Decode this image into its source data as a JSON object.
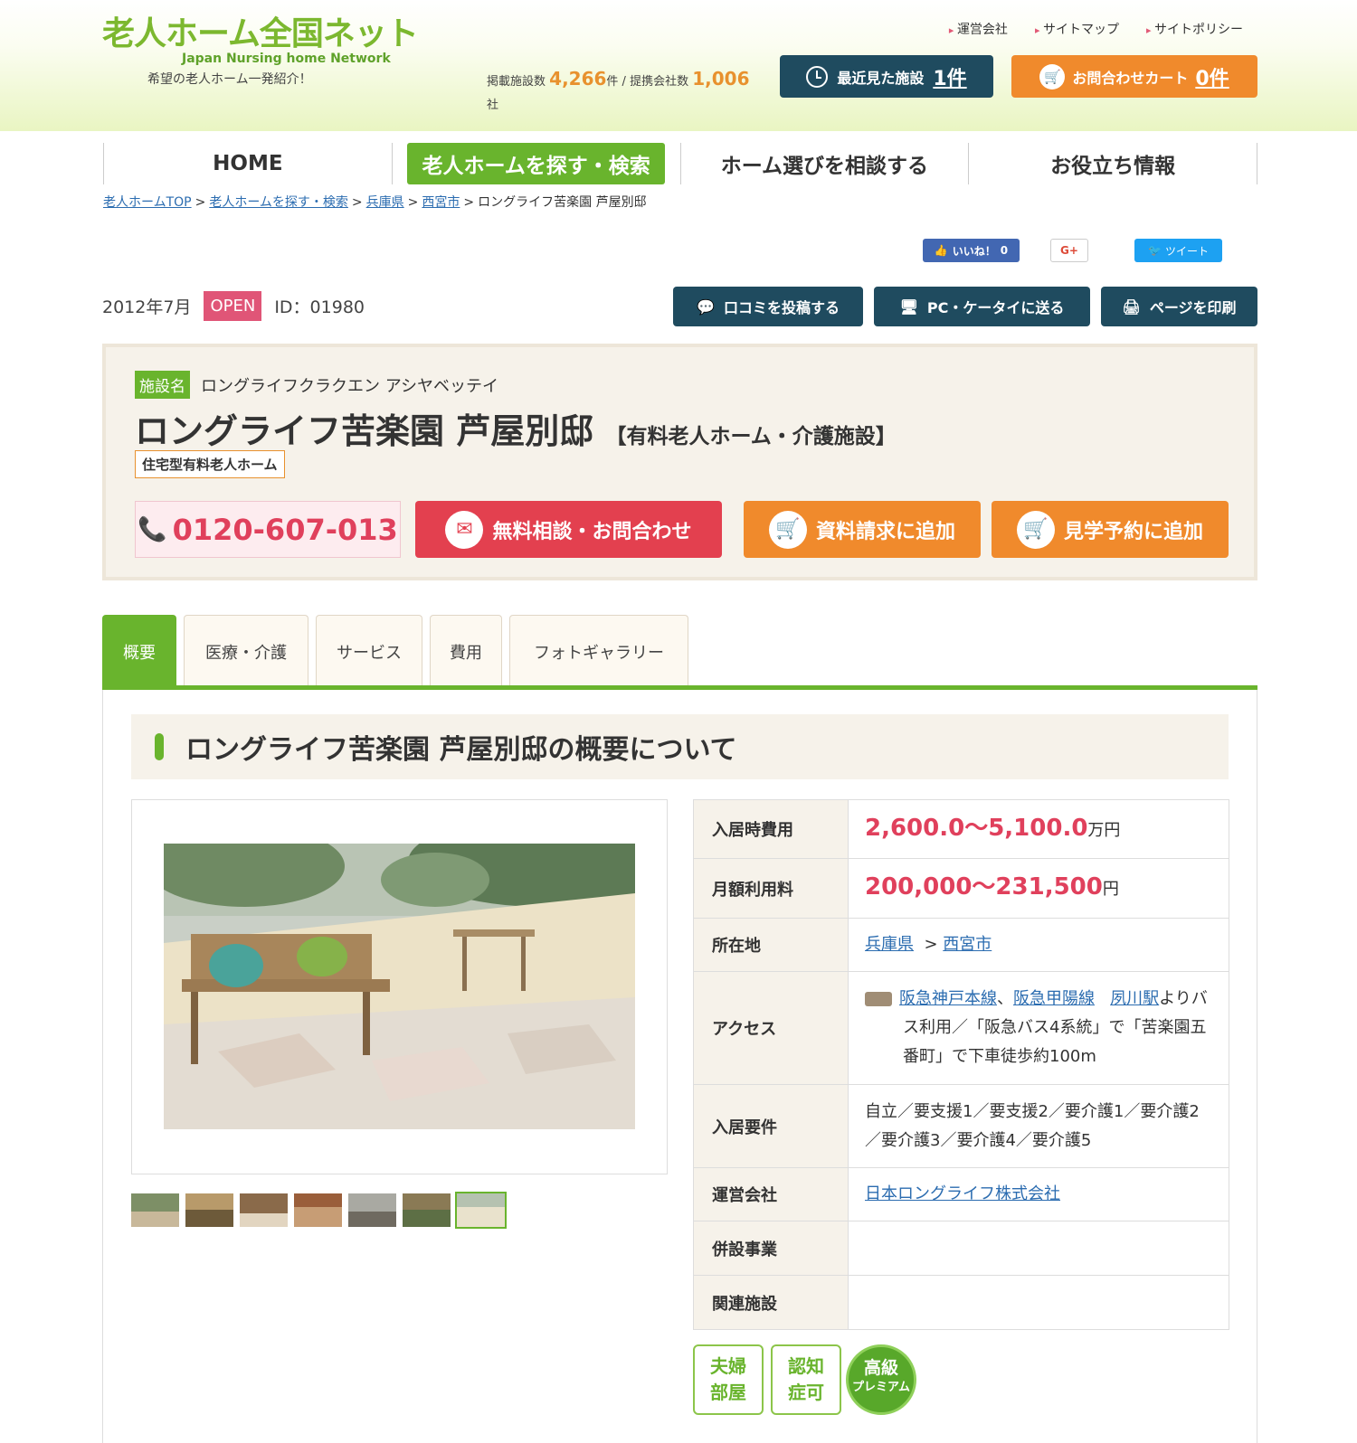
{
  "header": {
    "logo_main": "老人ホーム全国ネット",
    "logo_sub": "Japan Nursing home Network",
    "tagline": "希望の老人ホーム一発紹介！",
    "top_links": [
      "運営会社",
      "サイトマップ",
      "サイトポリシー"
    ],
    "counts": {
      "label1": "掲載施設数",
      "facilities": "4,266",
      "unit1": "件 / ",
      "label2": "提携会社数",
      "companies": "1,006",
      "unit2": "社"
    },
    "recent_label": "最近見た施設",
    "recent_count": "1件",
    "cart_label": "お問合わせカート",
    "cart_count": "0件"
  },
  "nav": [
    "HOME",
    "老人ホームを探す・検索",
    "ホーム選びを相談する",
    "お役立ち情報"
  ],
  "breadcrumb": {
    "items": [
      "老人ホームTOP",
      "老人ホームを探す・検索",
      "兵庫県",
      "西宮市"
    ],
    "current": "ロングライフ苦楽園 芦屋別邸",
    "sep": ">"
  },
  "social": {
    "like": "いいね！",
    "like_count": "0",
    "gplus": "G+",
    "tweet": "ツイート"
  },
  "meta": {
    "date": "2012年7月",
    "status": "OPEN",
    "id": "ID：01980"
  },
  "actions": [
    "口コミを投稿する",
    "PC・ケータイに送る",
    "ページを印刷"
  ],
  "facility": {
    "name_tag": "施設名",
    "kana": "ロングライフクラクエン アシヤベッテイ",
    "name": "ロングライフ苦楽園 芦屋別邸",
    "type": "【有料老人ホーム・介護施設】",
    "subtype": "住宅型有料老人ホーム",
    "tel": "0120-607-013",
    "btn_contact": "無料相談・お問合わせ",
    "btn_docs": "資料請求に追加",
    "btn_visit": "見学予約に追加"
  },
  "tabs": [
    "概要",
    "医療・介護",
    "サービス",
    "費用",
    "フォトギャラリー"
  ],
  "section_title": "ロングライフ苦楽園 芦屋別邸の概要について",
  "info": {
    "entry_fee_label": "入居時費用",
    "entry_fee": "2,600.0〜5,100.0",
    "entry_fee_unit": "万円",
    "monthly_label": "月額利用料",
    "monthly": "200,000〜231,500",
    "monthly_unit": "円",
    "location_label": "所在地",
    "pref": "兵庫県",
    "city": "西宮市",
    "access_label": "アクセス",
    "access_line1": "阪急神戸本線",
    "access_comma": "、",
    "access_line2": "阪急甲陽線",
    "access_station": "夙川駅",
    "access_text": "よりバス利用／「阪急バス4系統」で「苦楽園五番町」で下車徒歩約100m",
    "req_label": "入居要件",
    "requirements": "自立／要支援1／要支援2／要介護1／要介護2／要介護3／要介護4／要介護5",
    "company_label": "運営会社",
    "company": "日本ロングライフ株式会社",
    "annex_label": "併設事業",
    "annex": "",
    "related_label": "関連施設",
    "related": ""
  },
  "badges": {
    "couple_1": "夫婦",
    "couple_2": "部屋",
    "dementia_1": "認知",
    "dementia_2": "症可",
    "premium_1": "高級",
    "premium_2": "プレミアム"
  },
  "colors": {
    "green": "#69b42d",
    "orange": "#f08a2c",
    "navy": "#1f4b5f",
    "pink": "#e0405c"
  },
  "thumbnail_count": 7
}
